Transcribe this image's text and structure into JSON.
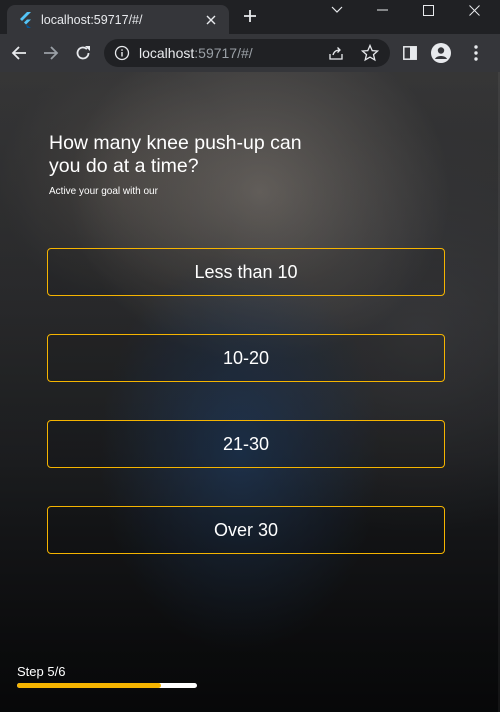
{
  "browser": {
    "tab_title": "localhost:59717/#/",
    "url_host": "localhost",
    "url_rest": ":59717/#/"
  },
  "quiz": {
    "question": "How many knee push-up can you do at a time?",
    "subtitle": "Active your goal with our",
    "options": [
      {
        "label": "Less than 10"
      },
      {
        "label": "10-20"
      },
      {
        "label": "21-30"
      },
      {
        "label": "Over 30"
      }
    ],
    "step_label": "Step 5/6",
    "progress_fraction": 0.8
  },
  "colors": {
    "accent": "#f5b400",
    "text": "#ffffff"
  },
  "icons": {
    "favicon": "flutter-logo-icon",
    "back": "arrow-left-icon",
    "forward": "arrow-right-icon",
    "reload": "reload-icon",
    "info": "info-icon",
    "share": "share-icon",
    "bookmark": "star-icon",
    "side_panel": "side-panel-icon",
    "profile": "profile-icon",
    "menu": "kebab-menu-icon"
  }
}
